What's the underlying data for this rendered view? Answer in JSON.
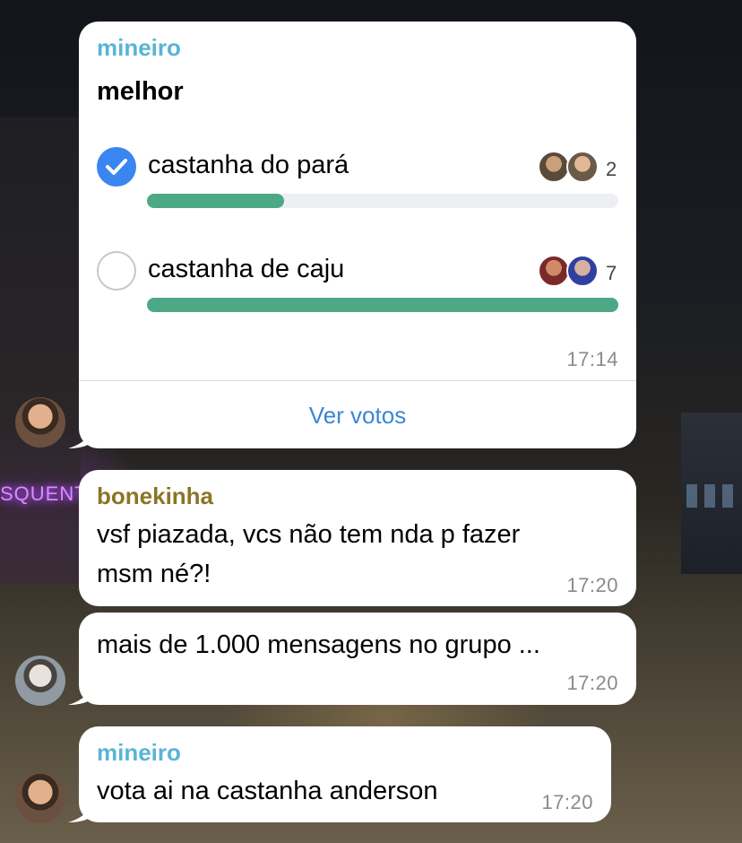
{
  "colors": {
    "bubble_bg": "#ffffff",
    "sender_mineiro": "#5ab4d6",
    "sender_bonekinha": "#8b7526",
    "check_blue": "#3a86f0",
    "poll_bar": "#4da886",
    "link_blue": "#3a86d6"
  },
  "poll_message": {
    "sender": "mineiro",
    "question": "melhor",
    "options": [
      {
        "label": "castanha do pará",
        "votes": "2",
        "selected": true,
        "fraction": 0.29
      },
      {
        "label": "castanha de caju",
        "votes": "7",
        "selected": false,
        "fraction": 1.0
      }
    ],
    "time": "17:14",
    "action_label": "Ver votos"
  },
  "messages": [
    {
      "sender": "bonekinha",
      "lines": [
        "vsf piazada, vcs não tem nda p fazer",
        "msm né?!"
      ],
      "time": "17:20"
    },
    {
      "text": "mais de 1.000 mensagens no grupo ...",
      "time": "17:20"
    },
    {
      "sender": "mineiro",
      "text": "vota ai na castanha anderson",
      "time": "17:20"
    }
  ],
  "background_sign": "SQUENTA",
  "icons": [
    "checkmark-icon",
    "radio-empty-icon",
    "voter-avatar",
    "user-avatar"
  ]
}
